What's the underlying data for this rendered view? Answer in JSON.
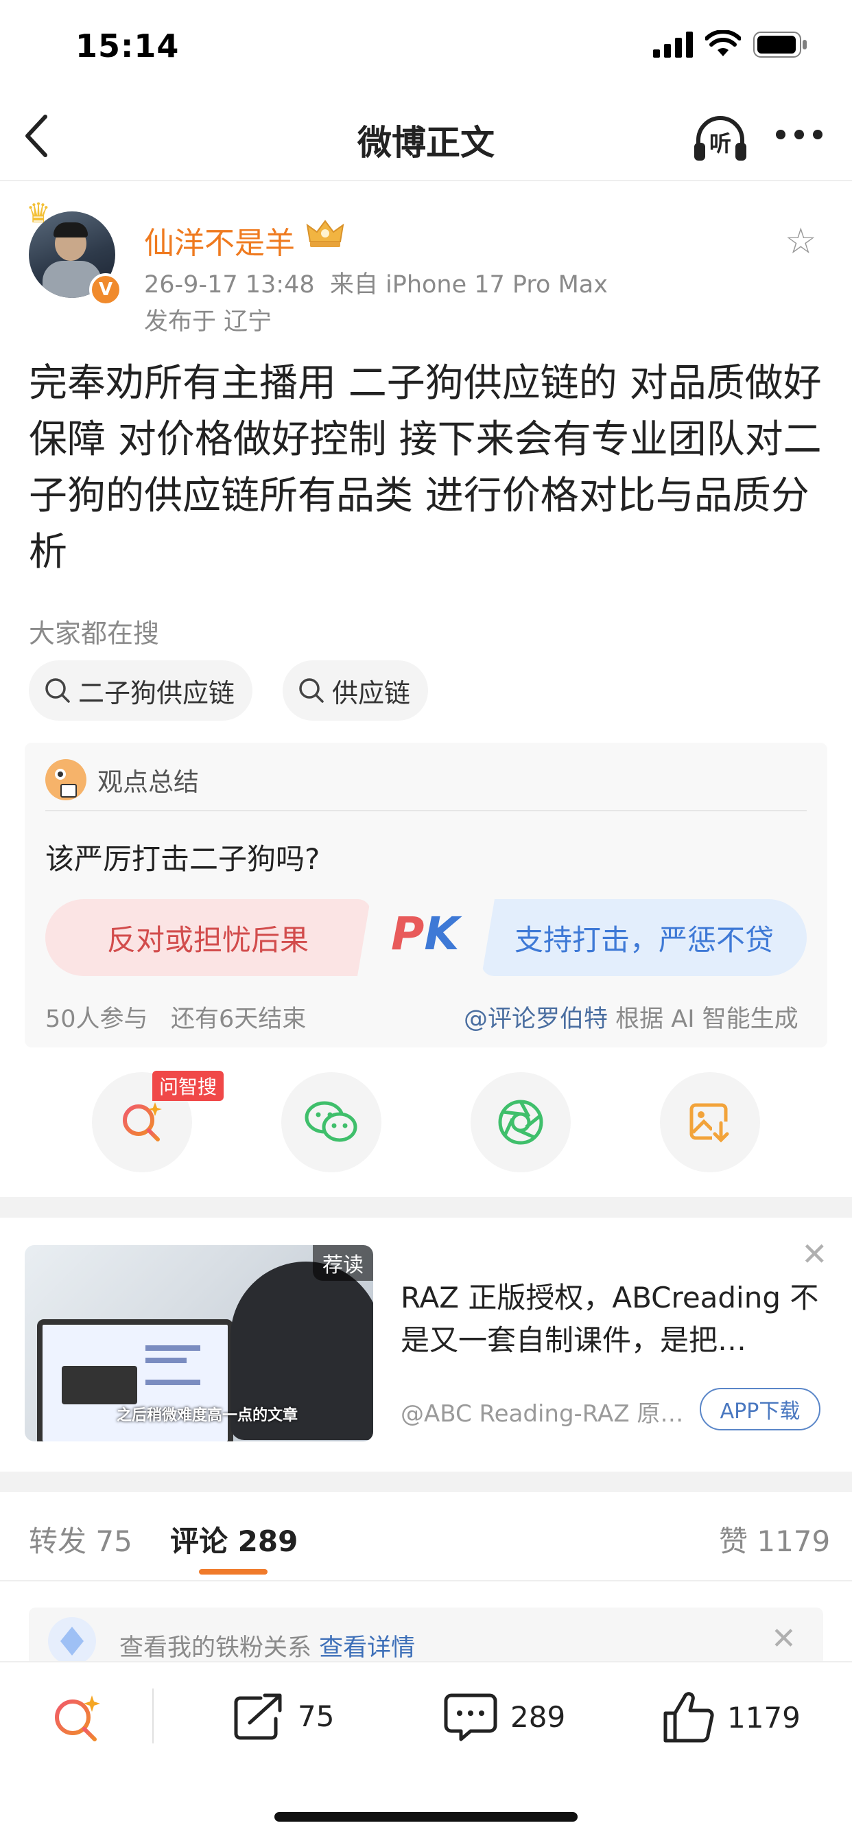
{
  "status_bar": {
    "time": "15:14"
  },
  "header": {
    "title": "微博正文",
    "listen_label": "听"
  },
  "author": {
    "name": "仙洋不是羊",
    "timestamp": "26-9-17 13:48",
    "source": "来自 iPhone 17 Pro Max",
    "location": "发布于 辽宁",
    "verified_badge": "V"
  },
  "post": {
    "text": "完奉劝所有主播用 二子狗供应链的 对品质做好保障 对价格做好控制 接下来会有专业团队对二子狗的供应链所有品类 进行价格对比与品质分析"
  },
  "search": {
    "title": "大家都在搜",
    "chips": [
      "二子狗供应链",
      "供应链"
    ]
  },
  "opinion": {
    "title": "观点总结",
    "question": "该严厉打击二子狗吗?",
    "oppose_label": "反对或担忧后果",
    "support_label": "支持打击，严惩不贷",
    "pk_p": "P",
    "pk_k": "K",
    "participants": "50人参与",
    "remaining": "还有6天结束",
    "credit_link": "@评论罗伯特",
    "credit_suffix": "根据 AI 智能生成"
  },
  "actions": {
    "ai_tag": "问智搜"
  },
  "ad": {
    "tag": "荐读",
    "caption": "之后稍微难度高一点的文章",
    "title": "RAZ 正版授权，ABCreading 不是又一套自制课件，是把…",
    "source": "@ABC Reading-RAZ 原…",
    "button": "APP下载"
  },
  "tabs": {
    "repost": "转发 75",
    "comment": "评论 289",
    "like": "赞 1179"
  },
  "fan_bar": {
    "text": "查看我的铁粉关系",
    "link": "查看详情"
  },
  "bottom_bar": {
    "repost_count": "75",
    "comment_count": "289",
    "like_count": "1179"
  },
  "colors": {
    "accent_orange": "#ef7a1f",
    "link_blue": "#3d6fb8",
    "pk_red": "#e85a5a",
    "pk_blue": "#3e79d6"
  }
}
